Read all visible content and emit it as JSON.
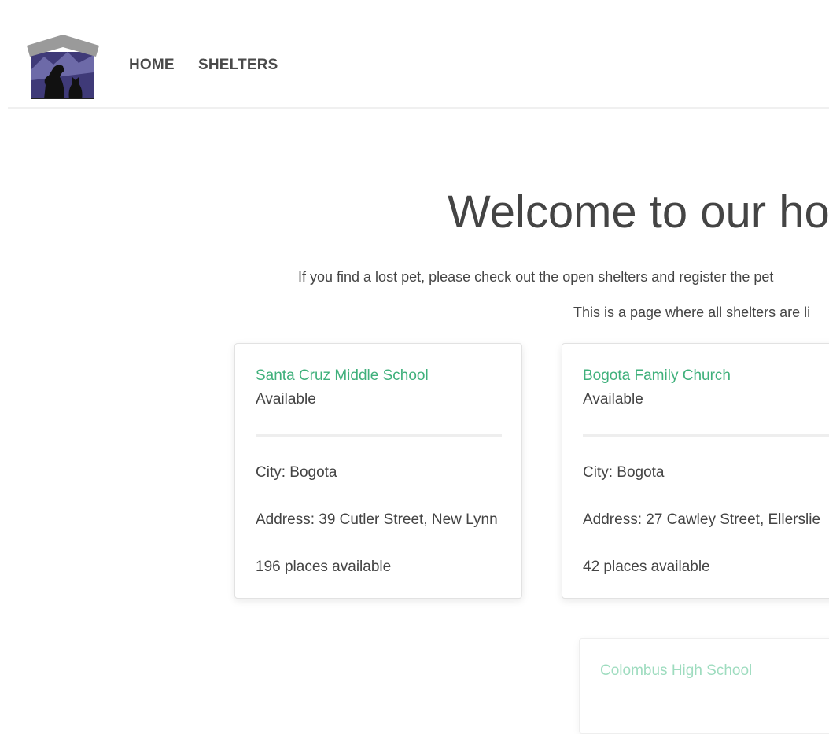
{
  "nav": {
    "logo_alt": "Pet shelter logo",
    "items": [
      {
        "label": "HOME"
      },
      {
        "label": "SHELTERS"
      }
    ]
  },
  "hero": {
    "title": "Welcome to our ho",
    "text_1": "If you find a lost pet, please check out the open shelters and register the pet",
    "text_2": "This is a page where all shelters are li"
  },
  "shelters": [
    {
      "name": "Santa Cruz Middle School",
      "status": "Available",
      "city": "City: Bogota",
      "address": "Address: 39 Cutler Street, New Lynn",
      "places": "196 places available"
    },
    {
      "name": "Bogota Family Church",
      "status": "Available",
      "city": "City: Bogota",
      "address": "Address: 27 Cawley Street, Ellerslie",
      "places": "42 places available"
    },
    {
      "name": "Colombus High School"
    }
  ],
  "colors": {
    "accent": "#3fb07b",
    "text": "#444444",
    "logo_roof": "#9a9a9a",
    "logo_wall": "#3f3a78"
  }
}
